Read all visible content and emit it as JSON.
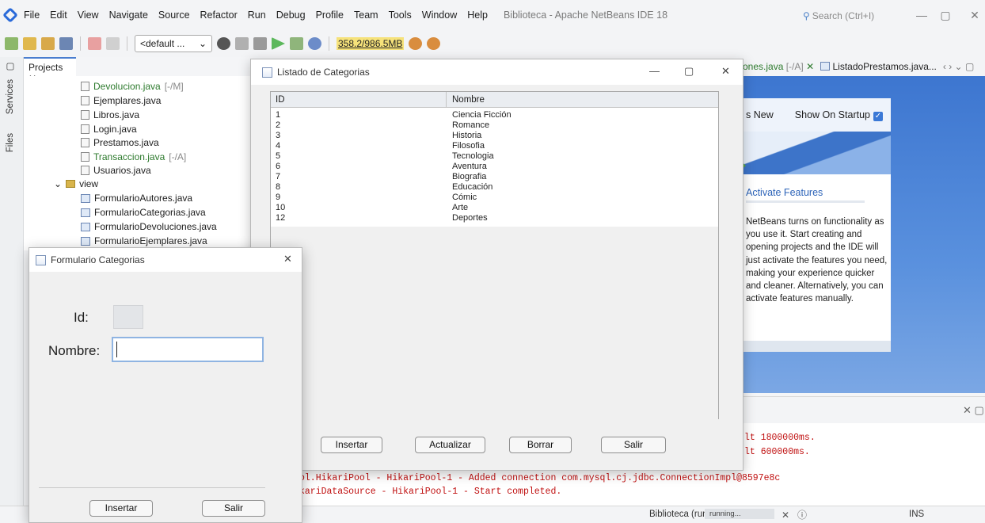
{
  "ide": {
    "menu": [
      "File",
      "Edit",
      "View",
      "Navigate",
      "Source",
      "Refactor",
      "Run",
      "Debug",
      "Profile",
      "Team",
      "Tools",
      "Window",
      "Help"
    ],
    "title": "Biblioteca - Apache NetBeans IDE 18",
    "search_placeholder": "Search (Ctrl+I)",
    "config": "<default ...",
    "memory": "358.2/986.5MB",
    "side_tabs": [
      "Services",
      "Files"
    ],
    "projects_tab": "Projects",
    "tree": [
      {
        "name": "Devolucion.java",
        "tag": "[-/M]",
        "state": "modified"
      },
      {
        "name": "Ejemplares.java"
      },
      {
        "name": "Libros.java"
      },
      {
        "name": "Login.java"
      },
      {
        "name": "Prestamos.java"
      },
      {
        "name": "Transaccion.java",
        "tag": "[-/A]",
        "state": "modified"
      },
      {
        "name": "Usuarios.java"
      },
      {
        "name": "view",
        "kind": "package"
      },
      {
        "name": "FormularioAutores.java",
        "kind": "form"
      },
      {
        "name": "FormularioCategorias.java",
        "kind": "form"
      },
      {
        "name": "FormularioDevoluciones.java",
        "kind": "form"
      },
      {
        "name": "FormularioEjemplares.java",
        "kind": "form"
      }
    ],
    "editor_tabs": {
      "tab1": "ones.java",
      "tab1_tag": "[-/A]",
      "tab2": "ListadoPrestamos.java...",
      "nav": "‹ › ⌄ ▢"
    },
    "start_page": {
      "whats_new": "s New",
      "show_on_startup": "Show On Startup",
      "activate_title": "Activate Features",
      "activate_text": "NetBeans turns on functionality as you use it. Start creating and opening projects and the IDE will just activate the features you need, making your experience quicker and cleaner. Alternatively, you can activate features manually."
    },
    "output_lines": [
      "lt 1800000ms.",
      "lt 600000ms.",
      "ol.HikariPool - HikariPool-1 - Added connection com.mysql.cj.jdbc.ConnectionImpl@8597e8c",
      "kariDataSource - HikariPool-1 - Start completed."
    ],
    "status": {
      "run": "Biblioteca (run)",
      "progress": "running...",
      "ins": "INS"
    }
  },
  "listado": {
    "title": "Listado de Categorias",
    "columns": [
      "ID",
      "Nombre"
    ],
    "rows": [
      {
        "id": "1",
        "nombre": "Ciencia Ficción"
      },
      {
        "id": "2",
        "nombre": "Romance"
      },
      {
        "id": "3",
        "nombre": "Historia"
      },
      {
        "id": "4",
        "nombre": "Filosofia"
      },
      {
        "id": "5",
        "nombre": "Tecnologia"
      },
      {
        "id": "6",
        "nombre": "Aventura"
      },
      {
        "id": "7",
        "nombre": "Biografia"
      },
      {
        "id": "8",
        "nombre": "Educación"
      },
      {
        "id": "9",
        "nombre": "Cómic"
      },
      {
        "id": "10",
        "nombre": "Arte"
      },
      {
        "id": "12",
        "nombre": "Deportes"
      }
    ],
    "buttons": {
      "insertar": "Insertar",
      "actualizar": "Actualizar",
      "borrar": "Borrar",
      "salir": "Salir"
    }
  },
  "form": {
    "title": "Formulario Categorias",
    "id_label": "Id:",
    "id_value": "",
    "nombre_label": "Nombre:",
    "nombre_value": "",
    "buttons": {
      "insertar": "Insertar",
      "salir": "Salir"
    }
  },
  "colors": {
    "accent": "#3a78d6",
    "modified_text": "#2d7a2d",
    "output_text": "#c01010"
  }
}
